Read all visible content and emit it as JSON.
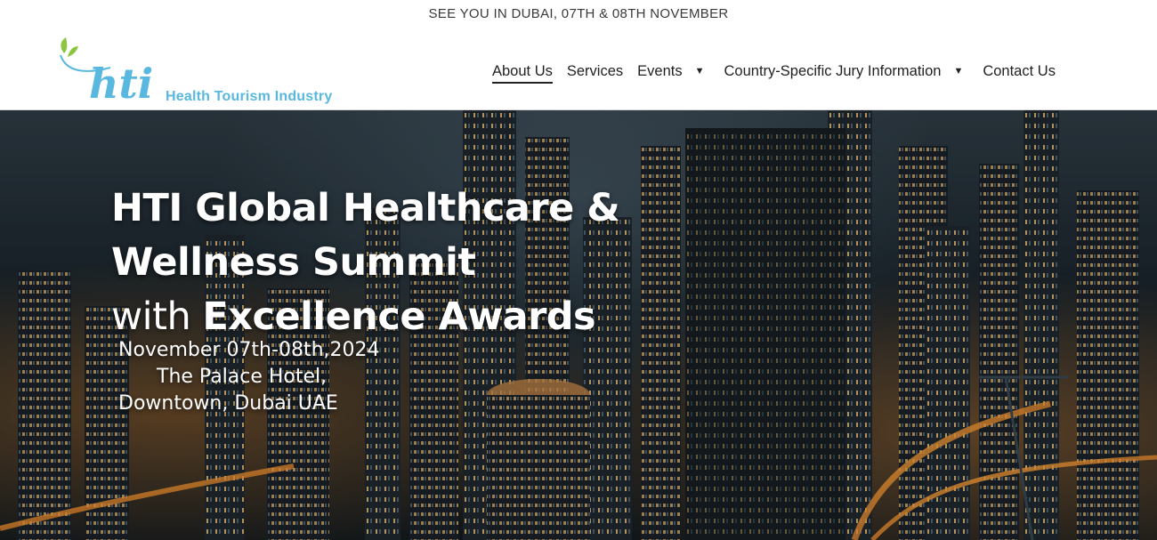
{
  "announcement": "SEE YOU IN DUBAI, 07TH & 08TH NOVEMBER",
  "logo": {
    "mark": "hti",
    "name": "Health Tourism Industry",
    "icon": "leaf-icon",
    "color": "#59b8df"
  },
  "nav": {
    "items": [
      {
        "label": "About Us",
        "active": true,
        "dropdown": false
      },
      {
        "label": "Services",
        "active": false,
        "dropdown": false
      },
      {
        "label": "Events",
        "active": false,
        "dropdown": true
      },
      {
        "label": "Country-Specific Jury Information",
        "active": false,
        "dropdown": true
      },
      {
        "label": "Contact Us",
        "active": false,
        "dropdown": false
      }
    ],
    "caret_glyph": "▼"
  },
  "hero": {
    "title_line1": "HTI Global Healthcare &",
    "title_line2": "Wellness Summit",
    "title_line3_light": "with ",
    "title_line3_bold": "Excellence Awards",
    "date": "November 07th-08th,2024",
    "venue": "The Palace Hotel,",
    "location": "Downtown, Dubai UAE",
    "background": "dubai-night-skyline"
  }
}
